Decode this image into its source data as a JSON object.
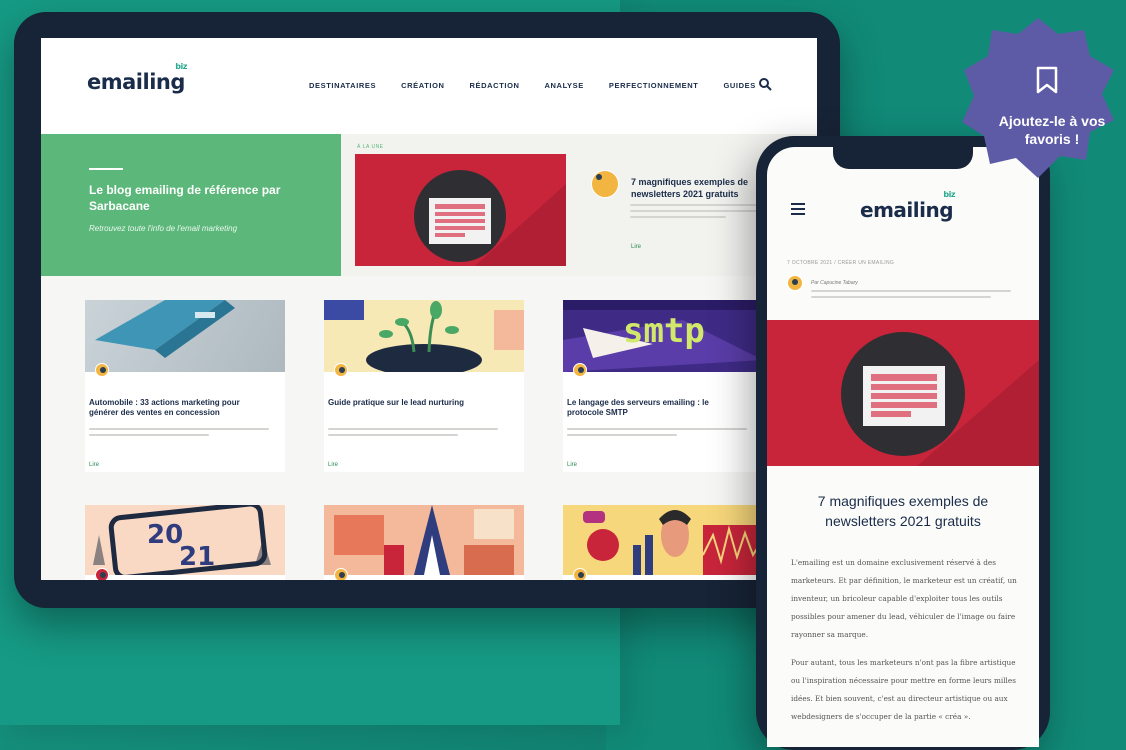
{
  "logo": {
    "text": "emailing",
    "suffix": "biz"
  },
  "nav": {
    "items": [
      "DESTINATAIRES",
      "CRÉATION",
      "RÉDACTION",
      "ANALYSE",
      "PERFECTIONNEMENT",
      "GUIDES"
    ]
  },
  "hero": {
    "title": "Le blog emailing de référence par Sarbacane",
    "subtitle": "Retrouvez toute l'info de l'email marketing",
    "kicker": "À LA UNE",
    "article_title": "7 magnifiques exemples de newsletters 2021 gratuits",
    "read_label": "Lire"
  },
  "cards": [
    {
      "title": "Automobile : 33 actions marketing pour générer des ventes en concession",
      "read_label": "Lire"
    },
    {
      "title": "Guide pratique sur le lead nurturing",
      "read_label": "Lire"
    },
    {
      "title": "Le langage des serveurs emailing : le protocole SMTP",
      "read_label": "Lire"
    }
  ],
  "smtp_text": "smtp",
  "year_text": {
    "top": "20",
    "bottom": "21"
  },
  "phone": {
    "meta": "7 OCTOBRE 2021 / CRÉER UN EMAILING",
    "author": "Par Capucine Tabary",
    "title": "7 magnifiques exemples de newsletters 2021 gratuits",
    "body": [
      "L'emailing est un domaine exclusivement réservé à des marketeurs. Et par définition, le marketeur est un créatif, un inventeur, un bricoleur capable d'exploiter tous les outils possibles pour amener du lead, véhiculer de l'image ou faire rayonner sa marque.",
      "Pour autant, tous les marketeurs n'ont pas la fibre artistique ou l'inspiration nécessaire pour mettre en forme leurs milles idées. Et bien souvent, c'est au directeur artistique ou aux webdesigners de s'occuper de la partie « créa »."
    ]
  },
  "badge": {
    "text": "Ajoutez-le à vos favoris !",
    "color": "#5d5aa6"
  },
  "colors": {
    "green": "#5cb87a",
    "red": "#c8253b",
    "navy": "#1a2c4a",
    "teal": "#1a9b86"
  }
}
